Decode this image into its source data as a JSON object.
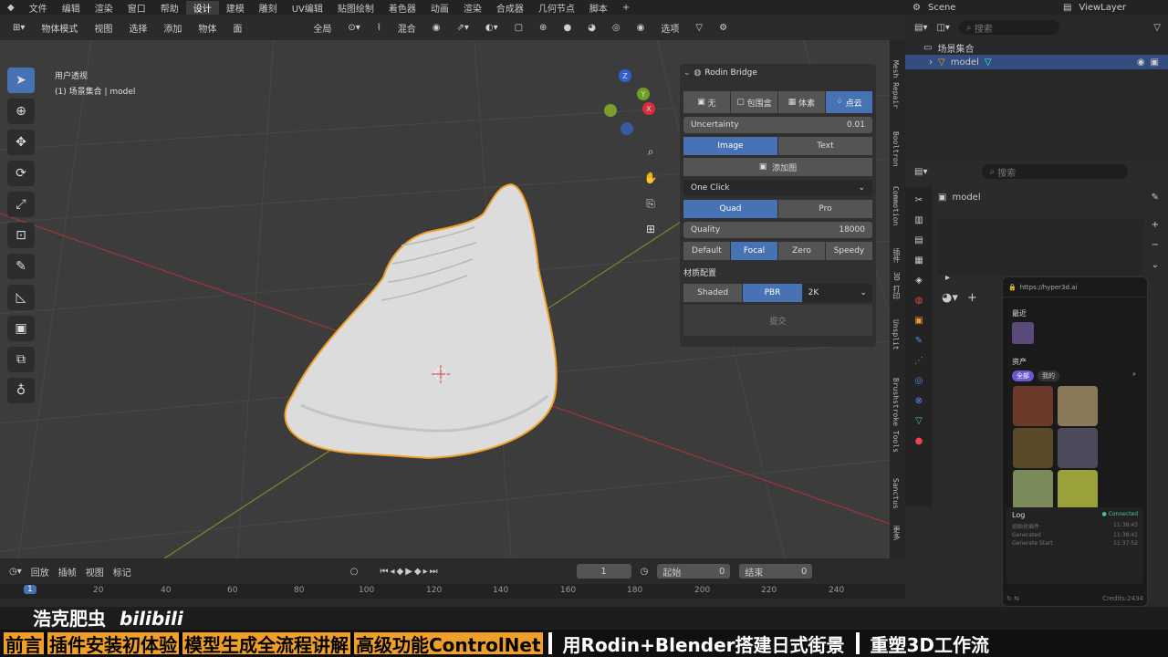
{
  "menu": {
    "items": [
      "文件",
      "编辑",
      "渲染",
      "窗口",
      "帮助"
    ],
    "workspaces": [
      "设计",
      "建模",
      "雕刻",
      "UV编辑",
      "贴图绘制",
      "着色器",
      "动画",
      "渲染",
      "合成器",
      "几何节点",
      "脚本"
    ],
    "active_workspace": "设计",
    "add_tab": "+",
    "scene": "Scene",
    "view_layer": "ViewLayer"
  },
  "header": {
    "mode": "物体模式",
    "view": "视图",
    "select": "选择",
    "add": "添加",
    "object": "物体",
    "face": "面",
    "global": "全局",
    "mix": "混合",
    "options": "选项"
  },
  "viewport": {
    "perspective": "用户透视",
    "collection_line": "(1) 场景集合 | model",
    "axes": {
      "x": "X",
      "y": "Y",
      "z": "Z"
    }
  },
  "rodin": {
    "title": "Rodin Bridge",
    "modes": [
      "无",
      "包围盒",
      "体素",
      "点云"
    ],
    "active_mode": "点云",
    "uncertainty_label": "Uncertainty",
    "uncertainty_value": "0.01",
    "image_tab": "Image",
    "text_tab": "Text",
    "add_image": "添加图",
    "one_click": "One Click",
    "quad": "Quad",
    "pro": "Pro",
    "quality_label": "Quality",
    "quality_value": "18000",
    "presets": [
      "Default",
      "Focal",
      "Zero",
      "Speedy"
    ],
    "active_preset": "Focal",
    "material_label": "材质配置",
    "shaded": "Shaded",
    "pbr": "PBR",
    "resolution": "2K",
    "submit": "提交"
  },
  "side_tabs": [
    "Mesh Repair",
    "Booltron",
    "Commotion",
    "插件",
    "3D 打印",
    "Unsplit",
    "Brushstroke Tools",
    "Sanctus",
    "更多"
  ],
  "outliner": {
    "search_placeholder": "搜索",
    "collection": "场景集合",
    "object": "model"
  },
  "properties": {
    "search_placeholder": "搜索",
    "object_name": "model"
  },
  "web": {
    "url": "https://hyper3d.ai",
    "recent": "最近",
    "assets": "资产",
    "tab_all": "全部",
    "tab_mine": "我的",
    "log_title": "Log",
    "connected": "Connected",
    "logs": [
      {
        "text": "初始化插件",
        "time": "11:38:43"
      },
      {
        "text": "Generated",
        "time": "11:38:41"
      },
      {
        "text": "Generate Start",
        "time": "11:37:52"
      }
    ],
    "credits": "Credits:2434"
  },
  "timeline": {
    "playback": "回放",
    "keying": "插帧",
    "view": "视图",
    "marker": "标记",
    "current_frame": "1",
    "start_label": "起始",
    "start_value": "0",
    "end_label": "结束",
    "end_value": "0",
    "ticks": [
      "1",
      "20",
      "40",
      "60",
      "80",
      "100",
      "120",
      "140",
      "160",
      "180",
      "200",
      "220",
      "240"
    ]
  },
  "watermark": {
    "author": "浩克肥虫",
    "site": "bilibili"
  },
  "chapters": [
    "前言",
    "插件安装初体验",
    "模型生成全流程讲解",
    "高级功能ControlNet",
    "用Rodin+Blender搭建日式街景",
    "重塑3D工作流"
  ],
  "colors": {
    "accent": "#4772b3",
    "highlight": "#f0a028",
    "viewport": "#3c3c3c"
  }
}
